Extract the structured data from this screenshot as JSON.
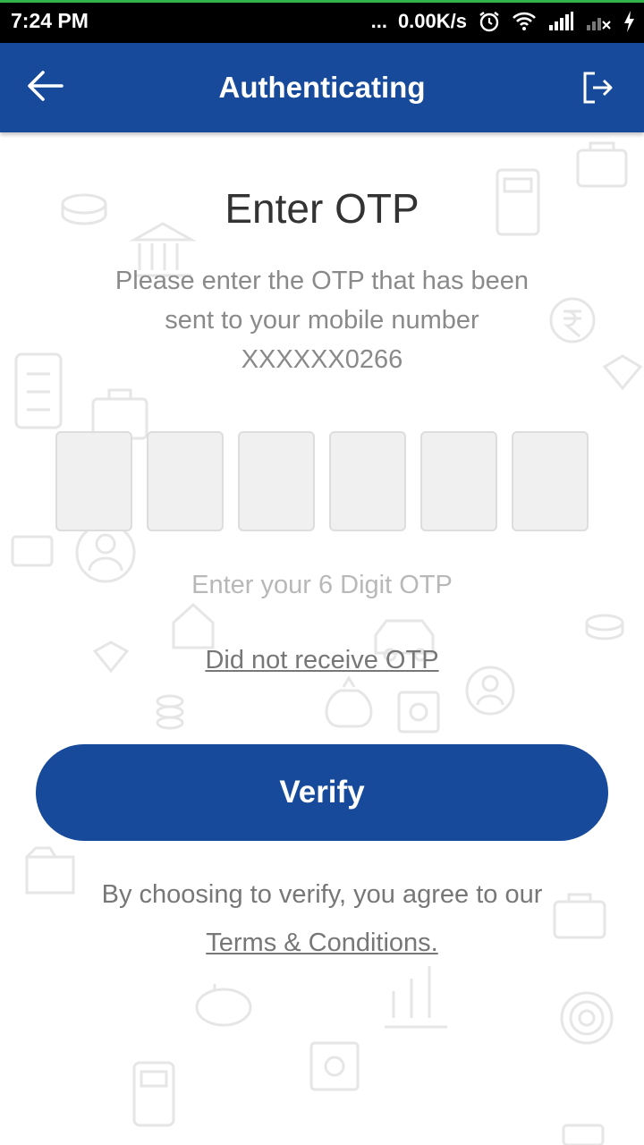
{
  "status_bar": {
    "time": "7:24 PM",
    "dots": "...",
    "network_speed": "0.00K/s",
    "icons": [
      "alarm-icon",
      "wifi-icon",
      "signal-icon",
      "signal-no-sim-icon",
      "charging-icon"
    ]
  },
  "app_bar": {
    "title": "Authenticating",
    "back_icon": "arrow-left-icon",
    "logout_icon": "logout-icon"
  },
  "otp": {
    "heading": "Enter OTP",
    "instructions": "Please enter the OTP that has been sent to your mobile number",
    "masked_number": "XXXXXX0266",
    "digits": [
      "",
      "",
      "",
      "",
      "",
      ""
    ],
    "hint": "Enter your 6 Digit OTP",
    "resend_link": "Did not receive OTP"
  },
  "verify_button": {
    "label": "Verify"
  },
  "footer": {
    "agree_text": "By choosing to verify, you agree to our",
    "terms_link": "Terms & Conditions."
  },
  "colors": {
    "primary": "#174a9a",
    "status_bar": "#000000",
    "status_accent": "#2fb34a",
    "heading_text": "#333333",
    "muted_text": "#8a8a8a",
    "hint_text": "#b8b8b8",
    "otp_box_bg": "#f0f0f0",
    "pattern": "#e8e8e8"
  }
}
